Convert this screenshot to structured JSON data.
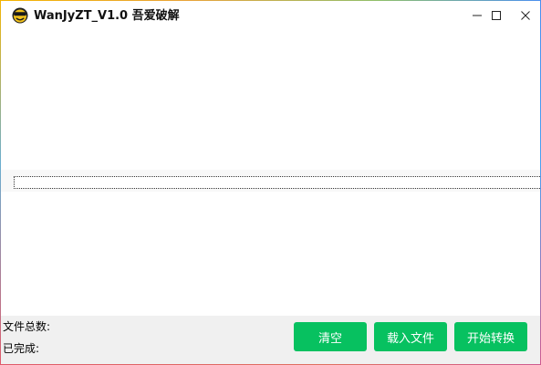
{
  "window": {
    "title": "WanJyZT_V1.0 吾爱破解",
    "icon": "smiley-sunglasses-icon",
    "controls": {
      "minimize": "minimize-icon",
      "maximize": "maximize-icon",
      "close": "close-icon"
    }
  },
  "status": {
    "total_files_label": "文件总数:",
    "completed_label": "已完成:"
  },
  "actions": {
    "clear_label": "清空",
    "load_label": "载入文件",
    "start_label": "开始转换"
  },
  "colors": {
    "accent_green": "#07c160",
    "panel_bg": "#f0f0f0"
  }
}
